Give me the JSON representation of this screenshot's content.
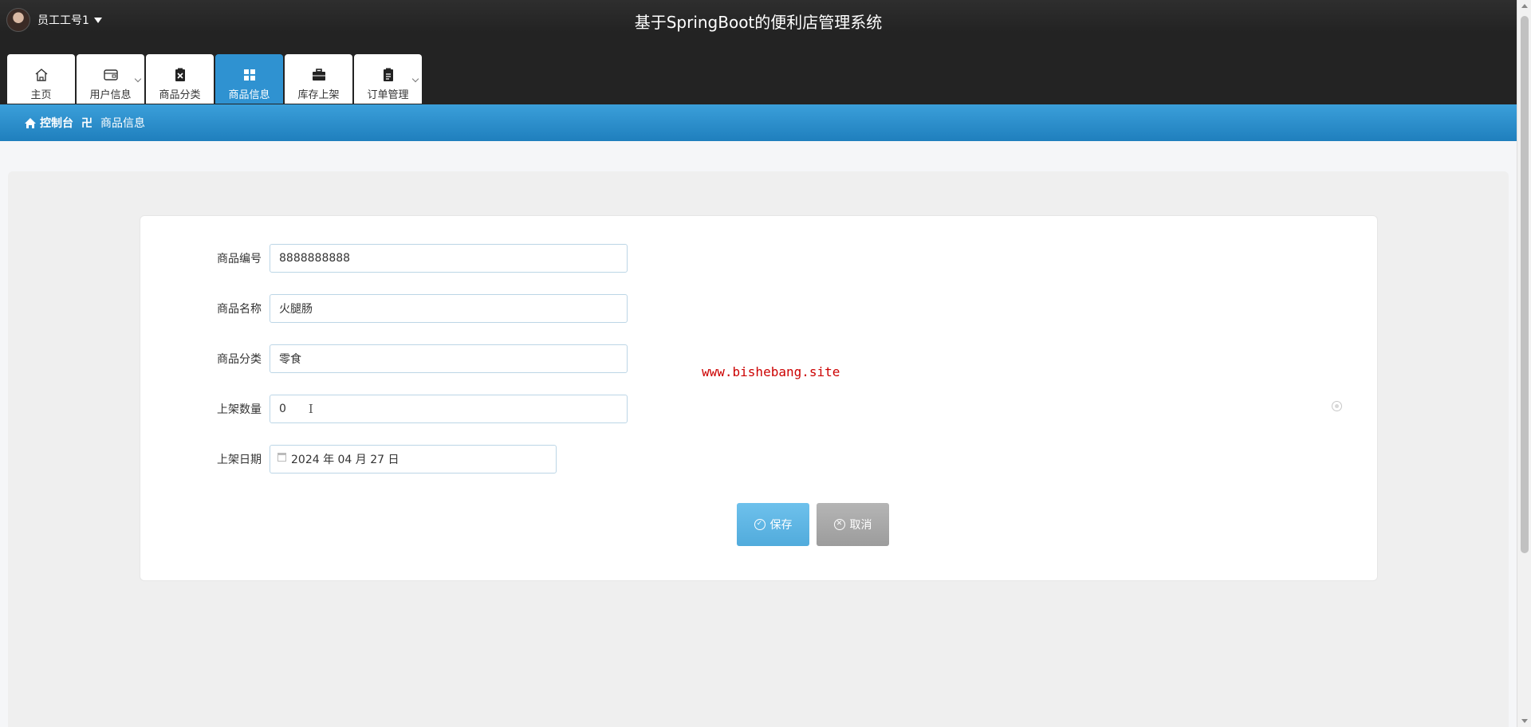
{
  "header": {
    "user_name": "员工工号1",
    "system_title": "基于SpringBoot的便利店管理系统"
  },
  "nav": {
    "tabs": [
      {
        "label": "主页",
        "icon": "home-icon",
        "active": false
      },
      {
        "label": "用户信息",
        "icon": "wallet-icon",
        "active": false,
        "has_dropdown": true
      },
      {
        "label": "商品分类",
        "icon": "clipboard-x-icon",
        "active": false
      },
      {
        "label": "商品信息",
        "icon": "grid-icon",
        "active": true
      },
      {
        "label": "库存上架",
        "icon": "briefcase-icon",
        "active": false
      },
      {
        "label": "订单管理",
        "icon": "clipboard-icon",
        "active": false,
        "has_dropdown": true
      }
    ]
  },
  "breadcrumb": {
    "home": "控制台",
    "separator": "卍",
    "current": "商品信息"
  },
  "form": {
    "fields": [
      {
        "label": "商品编号",
        "value": "8888888888"
      },
      {
        "label": "商品名称",
        "value": "火腿肠"
      },
      {
        "label": "商品分类",
        "value": "零食"
      },
      {
        "label": "上架数量",
        "value": "0"
      },
      {
        "label": "上架日期",
        "value": "2024 年 04 月 27 日"
      }
    ],
    "save_label": "保存",
    "cancel_label": "取消"
  },
  "watermark": "www.bishebang.site",
  "colors": {
    "topbar": "#232323",
    "accent": "#2f92d1",
    "save_button": "#5ab4e3",
    "cancel_button": "#a8a8a8"
  }
}
